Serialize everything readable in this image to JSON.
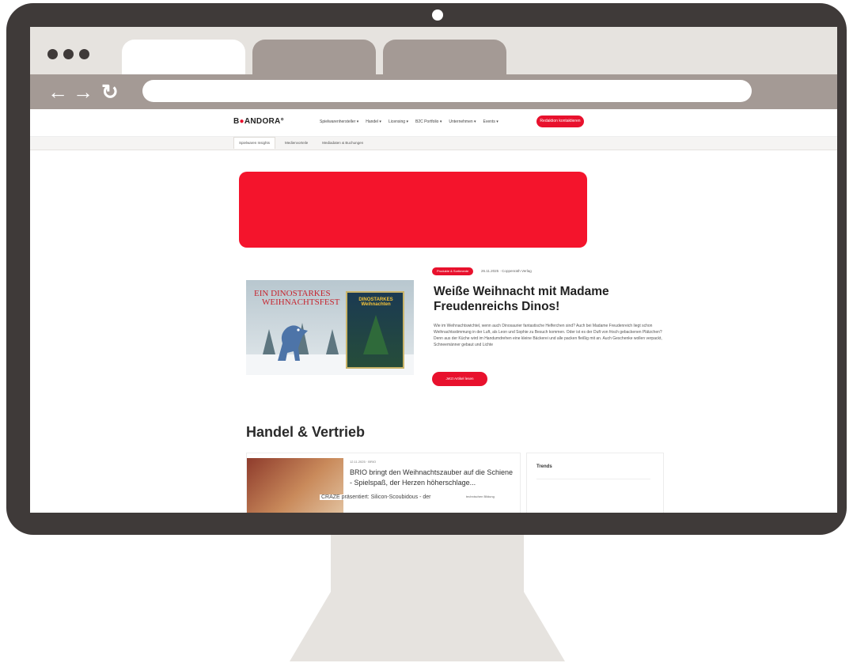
{
  "site": {
    "logo_prefix": "B",
    "logo_accent": "●",
    "logo_rest": "ANDORA",
    "logo_mark": "°",
    "menu": [
      "Spielwarenhersteller ▾",
      "Handel ▾",
      "Licensing ▾",
      "B2C Portfolio ▾",
      "Unternehmen ▾",
      "Events ▾"
    ],
    "cta": "Redaktion kontaktieren",
    "subnav": [
      "Spielwaren Insights",
      "Medienvorteile",
      "Mediadaten & Buchungen"
    ]
  },
  "featured": {
    "image_title_line1": "EIN DINOSTARKES",
    "image_title_line2": "WEIHNACHTSFEST",
    "book_title": "DINOSTARKES Weihnachten",
    "tag": "Produkte & Sortimente",
    "meta": "26.11.2025 · Coppenrath Verlag",
    "heading": "Weiße Weihnacht mit Madame Freudenreichs Dinos!",
    "text": "Wie im Weihnachtswichtel, wenn auch Dinosaurier fantastische Helferchen sind? Auch bei Madame Freudenreich liegt schon Weihnachtsstimmung in der Luft, als Leon und Sophie zu Besuch kommen. Oder ist es der Duft von frisch gebackenen Plätzchen? Denn aus der Küche wird im Handumdrehen eine kleine Bäckerei und alle packen fleißig mit an. Auch Geschenke wollen verpackt, Schneemänner gebaut und Lichte",
    "button": "Jetzt Artikel lesen"
  },
  "section": {
    "heading": "Handel & Vertrieb",
    "card_meta": "12.11.2025 · BRIO",
    "card_title": "BRIO bringt den Weihnachtszauber auf die Schiene - Spielspaß, der Herzen höherschlage...",
    "card_sub": "CRAZE präsentiert: Silicon-Scoubidous - der",
    "card_sub2": "technischen Bildung",
    "trends_label": "Trends"
  },
  "colors": {
    "accent": "#e8112d",
    "bezel": "#3f3a39",
    "chrome_tab": "#a49a95",
    "chrome_bar": "#e6e3df"
  },
  "icons": {
    "back": "back-arrow-icon",
    "forward": "forward-arrow-icon",
    "reload": "reload-icon"
  }
}
